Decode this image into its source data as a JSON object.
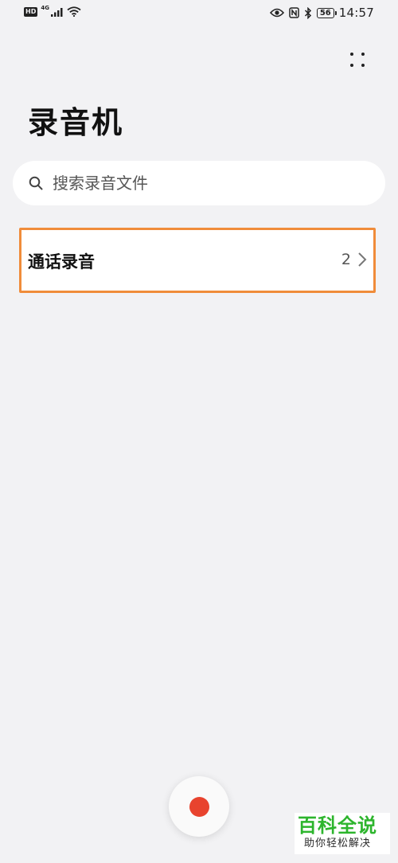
{
  "status_bar": {
    "hd_badge": "HD",
    "network": "4G",
    "battery": "56",
    "time": "14:57",
    "icons": [
      "signal-icon",
      "wifi-icon",
      "eye-icon",
      "nfc-icon",
      "bluetooth-icon",
      "battery-icon"
    ]
  },
  "header": {
    "title": "录音机",
    "menu_icon": "more-icon"
  },
  "search": {
    "placeholder": "搜索录音文件",
    "value": ""
  },
  "folders": [
    {
      "name": "通话录音",
      "count": "2"
    }
  ],
  "record": {
    "accent": "#e8432e"
  },
  "watermark": {
    "main": "百科全说",
    "sub": "助你轻松解决"
  },
  "colors": {
    "background": "#f2f2f4",
    "highlight": "#f08c3a",
    "watermark_green": "#2db52d"
  }
}
